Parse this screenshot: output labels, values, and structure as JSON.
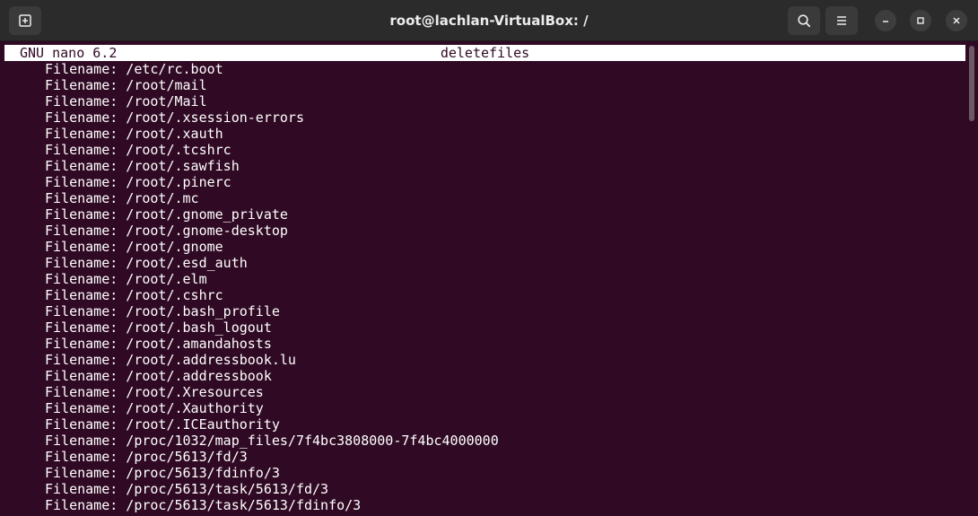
{
  "window": {
    "title": "root@lachlan-VirtualBox: /"
  },
  "titlebar": {
    "icons": {
      "new_tab": "new-tab-icon",
      "search": "search-icon",
      "menu": "hamburger-menu-icon",
      "minimize": "minimize-icon",
      "maximize": "maximize-icon",
      "close": "close-icon"
    }
  },
  "nano": {
    "version": "GNU nano 6.2",
    "filename": "deletefiles"
  },
  "lines": [
    "Filename: /etc/rc.boot",
    "Filename: /root/mail",
    "Filename: /root/Mail",
    "Filename: /root/.xsession-errors",
    "Filename: /root/.xauth",
    "Filename: /root/.tcshrc",
    "Filename: /root/.sawfish",
    "Filename: /root/.pinerc",
    "Filename: /root/.mc",
    "Filename: /root/.gnome_private",
    "Filename: /root/.gnome-desktop",
    "Filename: /root/.gnome",
    "Filename: /root/.esd_auth",
    "Filename: /root/.elm",
    "Filename: /root/.cshrc",
    "Filename: /root/.bash_profile",
    "Filename: /root/.bash_logout",
    "Filename: /root/.amandahosts",
    "Filename: /root/.addressbook.lu",
    "Filename: /root/.addressbook",
    "Filename: /root/.Xresources",
    "Filename: /root/.Xauthority",
    "Filename: /root/.ICEauthority",
    "Filename: /proc/1032/map_files/7f4bc3808000-7f4bc4000000",
    "Filename: /proc/5613/fd/3",
    "Filename: /proc/5613/fdinfo/3",
    "Filename: /proc/5613/task/5613/fd/3",
    "Filename: /proc/5613/task/5613/fdinfo/3"
  ],
  "colors": {
    "terminal_bg": "#300a24",
    "titlebar_bg": "#2b2b2b",
    "text": "#ffffff"
  }
}
